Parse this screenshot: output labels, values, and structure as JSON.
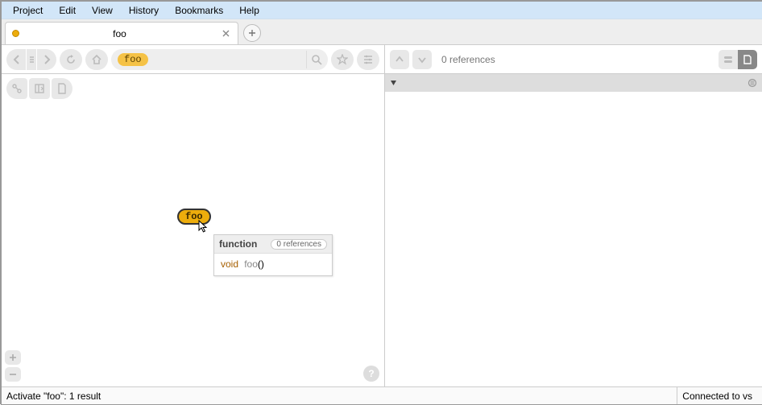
{
  "menu": {
    "project": "Project",
    "edit": "Edit",
    "view": "View",
    "history": "History",
    "bookmarks": "Bookmarks",
    "help": "Help"
  },
  "tab": {
    "title": "foo"
  },
  "search": {
    "value": "foo"
  },
  "refs_panel": {
    "count_text": "0 references"
  },
  "node": {
    "label": "foo"
  },
  "popup": {
    "kind": "function",
    "refs": "0 references",
    "sig_kw": "void",
    "sig_name": "foo",
    "sig_tail": "()"
  },
  "status": {
    "left": "Activate \"foo\": 1 result",
    "right": "Connected to vs"
  }
}
